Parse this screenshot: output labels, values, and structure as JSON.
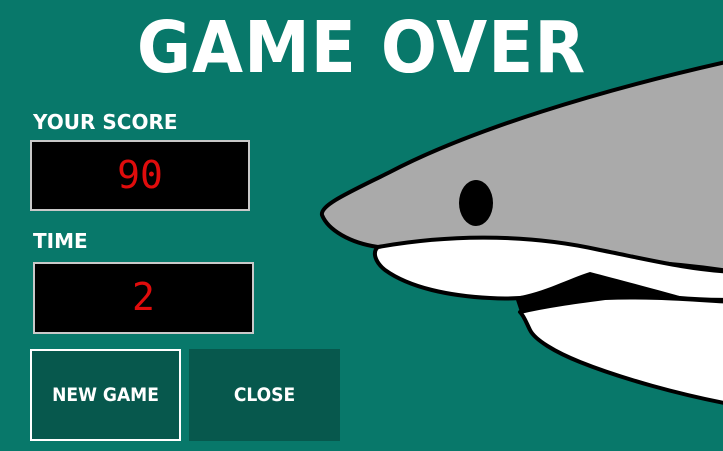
{
  "title": "GAME OVER",
  "score": {
    "label": "YOUR SCORE",
    "value": "90"
  },
  "time": {
    "label": "TIME",
    "value": "2"
  },
  "buttons": {
    "new_game": "NEW GAME",
    "close": "CLOSE"
  },
  "colors": {
    "background": "#08786a",
    "button": "#07584d",
    "display_text": "#e00c0c",
    "shark_body": "#aaaaaa"
  },
  "decor": {
    "shark": "shark-illustration"
  }
}
